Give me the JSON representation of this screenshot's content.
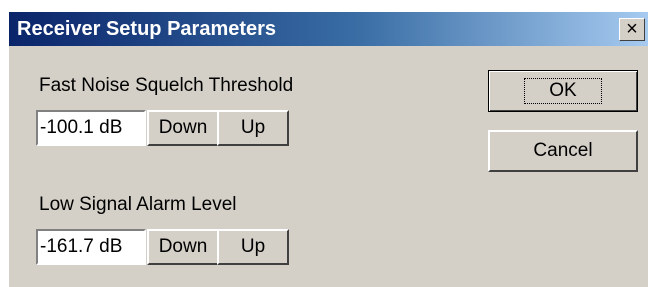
{
  "dialog": {
    "title": "Receiver Setup Parameters",
    "close_symbol": "×"
  },
  "squelch": {
    "label": "Fast Noise Squelch Threshold",
    "value": "-100.1 dB",
    "down_label": "Down",
    "up_label": "Up"
  },
  "alarm": {
    "label": "Low Signal Alarm Level",
    "value": "-161.7 dB",
    "down_label": "Down",
    "up_label": "Up"
  },
  "buttons": {
    "ok_label": "OK",
    "cancel_label": "Cancel"
  }
}
